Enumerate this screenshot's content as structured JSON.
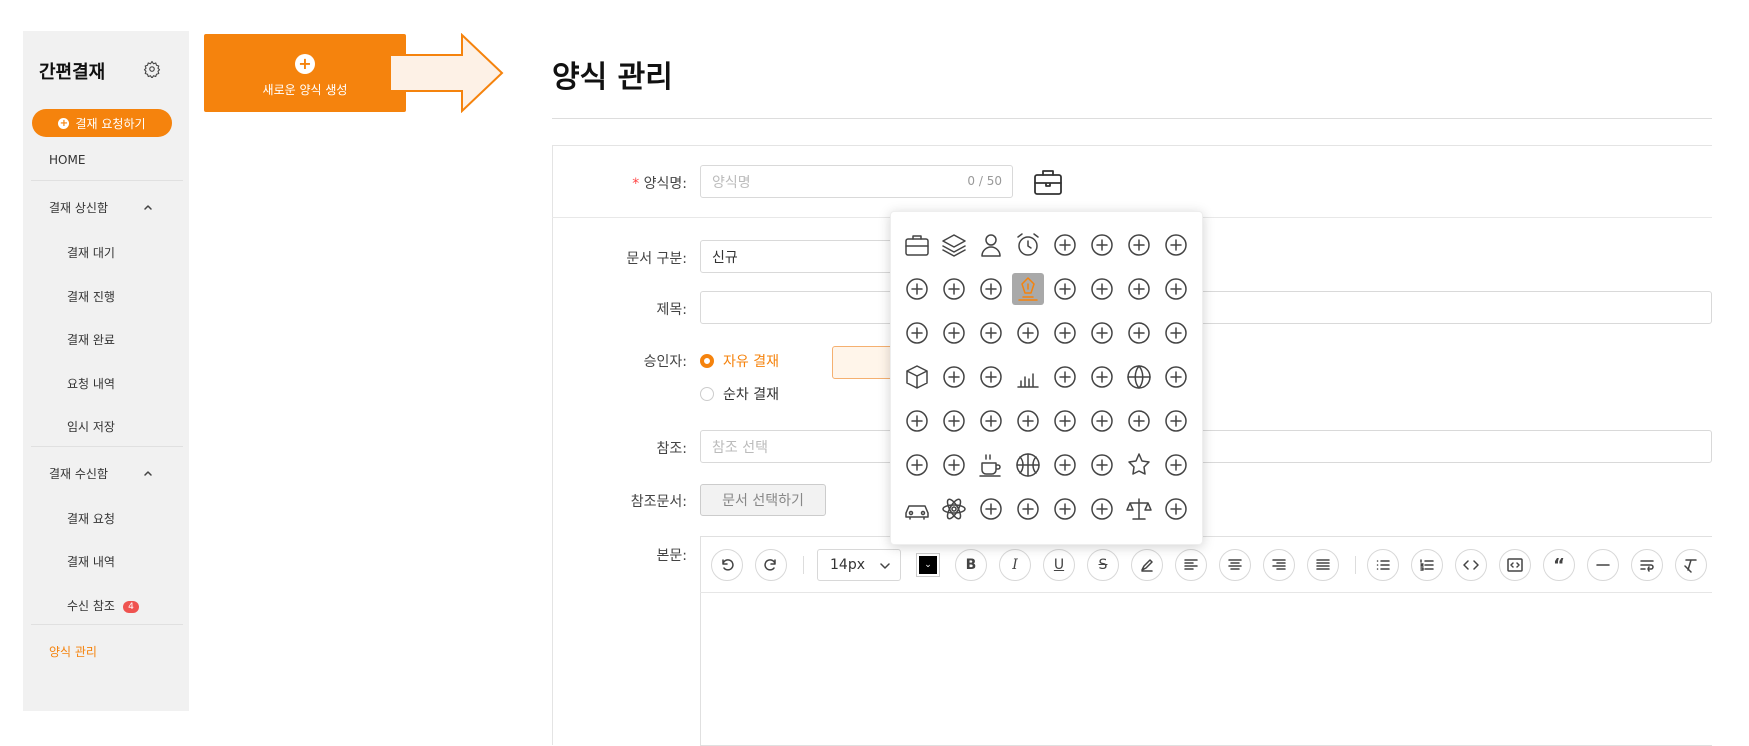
{
  "sidebar": {
    "title": "간편결재",
    "request_button": "결재 요청하기",
    "home": "HOME",
    "sent_group": "결재 상신함",
    "sent_items": [
      "결재 대기",
      "결재 진행",
      "결재 완료",
      "요청 내역",
      "임시 저장"
    ],
    "received_group": "결재 수신함",
    "received_items": [
      "결재 요청",
      "결재 내역",
      "수신 참조"
    ],
    "received_cc_badge": "4",
    "form_manage": "양식 관리"
  },
  "new_form_card": {
    "label": "새로운 양식 생성"
  },
  "page": {
    "title": "양식 관리"
  },
  "form": {
    "name_label": "양식명:",
    "name_required_mark": "*",
    "name_placeholder": "양식명",
    "name_count": "0 / 50",
    "doctype_label": "문서 구분:",
    "doctype_value": "신규",
    "subject_label": "제목:",
    "approver_label": "승인자:",
    "approver_options": [
      "자유 결재",
      "순차 결재"
    ],
    "approver_selected": "자유 결재",
    "ref_label": "참조:",
    "ref_placeholder": "참조 선택",
    "refdoc_label": "참조문서:",
    "refdoc_button": "문서 선택하기",
    "body_label": "본문:"
  },
  "editor": {
    "font_size": "14px",
    "text_color": "#000000",
    "tools": [
      "undo-icon",
      "redo-icon",
      "bold-icon",
      "italic-icon",
      "underline-icon",
      "strikethrough-icon",
      "highlight-icon",
      "align-left-icon",
      "align-center-icon",
      "align-right-icon",
      "align-justify-icon",
      "bullet-list-icon",
      "numbered-list-icon",
      "code-inline-icon",
      "code-block-icon",
      "quote-icon",
      "horizontal-rule-icon",
      "wrap-text-icon",
      "clear-format-icon"
    ]
  },
  "icon_picker": {
    "selected": "pen-nib-icon",
    "icons": [
      "briefcase-icon",
      "layers-icon",
      "user-icon",
      "alarm-clock-icon",
      "hand-money-icon",
      "group-icon",
      "people-icon",
      "office-building-icon",
      "user-circle-icon",
      "org-chart-icon",
      "coin-icon",
      "pen-nib-icon",
      "buildings-icon",
      "inbox-icon",
      "home-edit-icon",
      "broadcast-icon",
      "code-window-icon",
      "growth-chart-icon",
      "user-scan-icon",
      "handshake-icon",
      "lightbulb-icon",
      "browser-code-icon",
      "stars-icon",
      "video-camera-icon",
      "cube-icon",
      "list-box-icon",
      "hierarchy-icon",
      "bar-chart-icon",
      "ai-head-icon",
      "film-reel-icon",
      "globe-icon",
      "cycle-icon",
      "target-arrow-icon",
      "presentation-icon",
      "chat-icon",
      "award-icon",
      "network-icon",
      "head-drop-icon",
      "gender-icon",
      "couple-heart-icon",
      "baby-icon",
      "home-heart-icon",
      "coffee-icon",
      "basketball-icon",
      "paw-icon",
      "head-star-icon",
      "star-icon",
      "head-heart-icon",
      "car-icon",
      "atom-icon",
      "meal-icon",
      "hand-heart-icon",
      "gavel-icon",
      "house-family-icon",
      "scale-icon",
      "truck-icon"
    ]
  },
  "colors": {
    "accent": "#f5830d",
    "sidebar_bg": "#f1f1f1",
    "badge": "#ef5350"
  }
}
